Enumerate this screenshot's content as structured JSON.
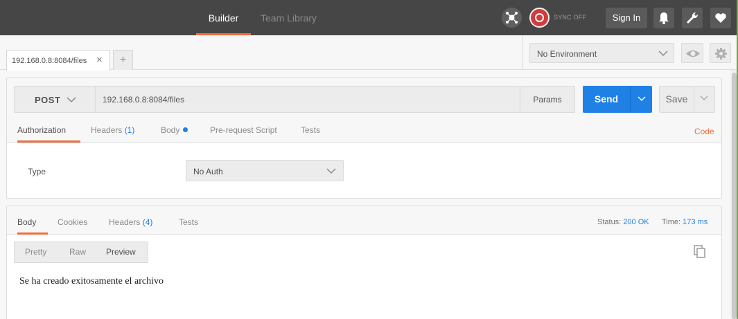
{
  "nav": {
    "tabs": [
      {
        "label": "Builder",
        "active": true
      },
      {
        "label": "Team Library",
        "active": false
      }
    ],
    "sync_label": "SYNC OFF",
    "signin_label": "Sign In",
    "icons": [
      "interceptor-icon",
      "sync-icon",
      "bell-icon",
      "wrench-icon",
      "heart-icon"
    ]
  },
  "tabs": {
    "open": [
      {
        "label": "192.168.0.8:8084/files"
      }
    ],
    "new_tab_label": "+",
    "close_glyph": "×"
  },
  "environment": {
    "selected": "No Environment"
  },
  "request": {
    "method": "POST",
    "url": "192.168.0.8:8084/files",
    "params_label": "Params",
    "send_label": "Send",
    "save_label": "Save",
    "tabs": [
      {
        "label": "Authorization",
        "active": true
      },
      {
        "label": "Headers",
        "count": "(1)"
      },
      {
        "label": "Body",
        "has_dot": true
      },
      {
        "label": "Pre-request Script"
      },
      {
        "label": "Tests"
      }
    ],
    "code_label": "Code",
    "auth": {
      "type_label": "Type",
      "selected": "No Auth"
    }
  },
  "response": {
    "tabs": [
      {
        "label": "Body",
        "active": true
      },
      {
        "label": "Cookies"
      },
      {
        "label": "Headers",
        "count": "(4)"
      },
      {
        "label": "Tests"
      }
    ],
    "status_label": "Status:",
    "status_value": "200 OK",
    "time_label": "Time:",
    "time_value": "173 ms",
    "view_modes": [
      {
        "label": "Pretty"
      },
      {
        "label": "Raw"
      },
      {
        "label": "Preview",
        "active": true
      }
    ],
    "body": "Se ha creado exitosamente el archivo"
  },
  "colors": {
    "accent": "#f26b3a",
    "primary": "#1f80e6",
    "topbar": "#464646",
    "sync": "#d03c3c"
  }
}
